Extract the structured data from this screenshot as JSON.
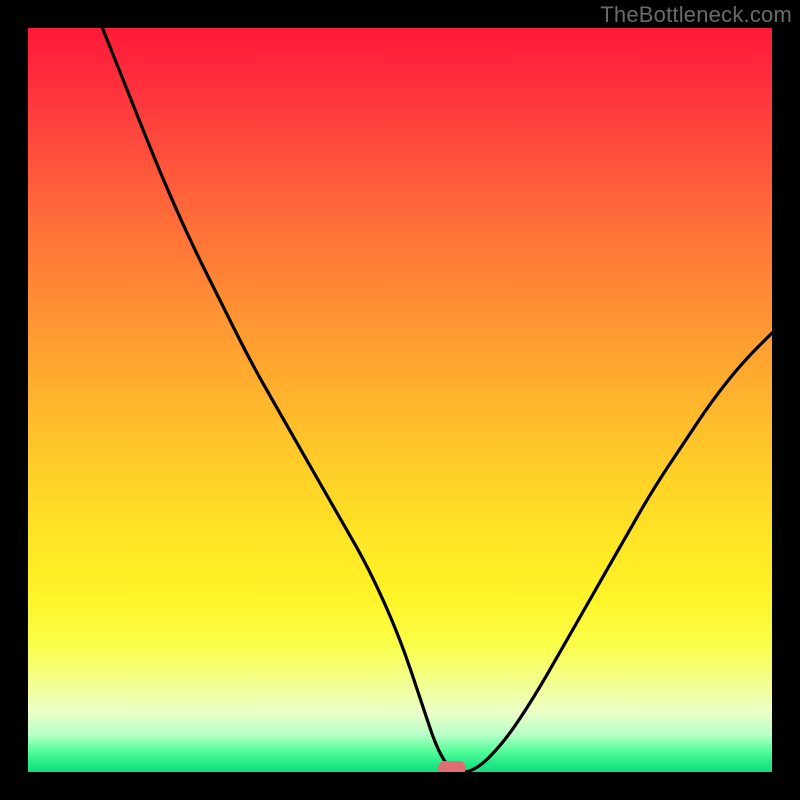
{
  "watermark": "TheBottleneck.com",
  "chart_data": {
    "type": "line",
    "title": "",
    "xlabel": "",
    "ylabel": "",
    "xlim": [
      0,
      100
    ],
    "ylim": [
      0,
      100
    ],
    "series": [
      {
        "name": "curve",
        "x": [
          10,
          14,
          18,
          22,
          26,
          30,
          34,
          38,
          42,
          46,
          50,
          53,
          55,
          57,
          60,
          64,
          68,
          72,
          76,
          80,
          84,
          88,
          92,
          96,
          100
        ],
        "values": [
          100,
          90,
          80,
          71,
          63,
          55,
          48,
          41,
          34,
          27,
          18,
          9,
          3,
          0,
          0,
          4,
          10,
          17,
          24,
          31,
          38,
          44,
          50,
          55,
          59
        ]
      }
    ],
    "marker": {
      "x": 57,
      "y": 0
    },
    "gradient_colors": {
      "top": "#ff1a3a",
      "mid": "#ffd028",
      "bottom": "#17db7b"
    }
  }
}
